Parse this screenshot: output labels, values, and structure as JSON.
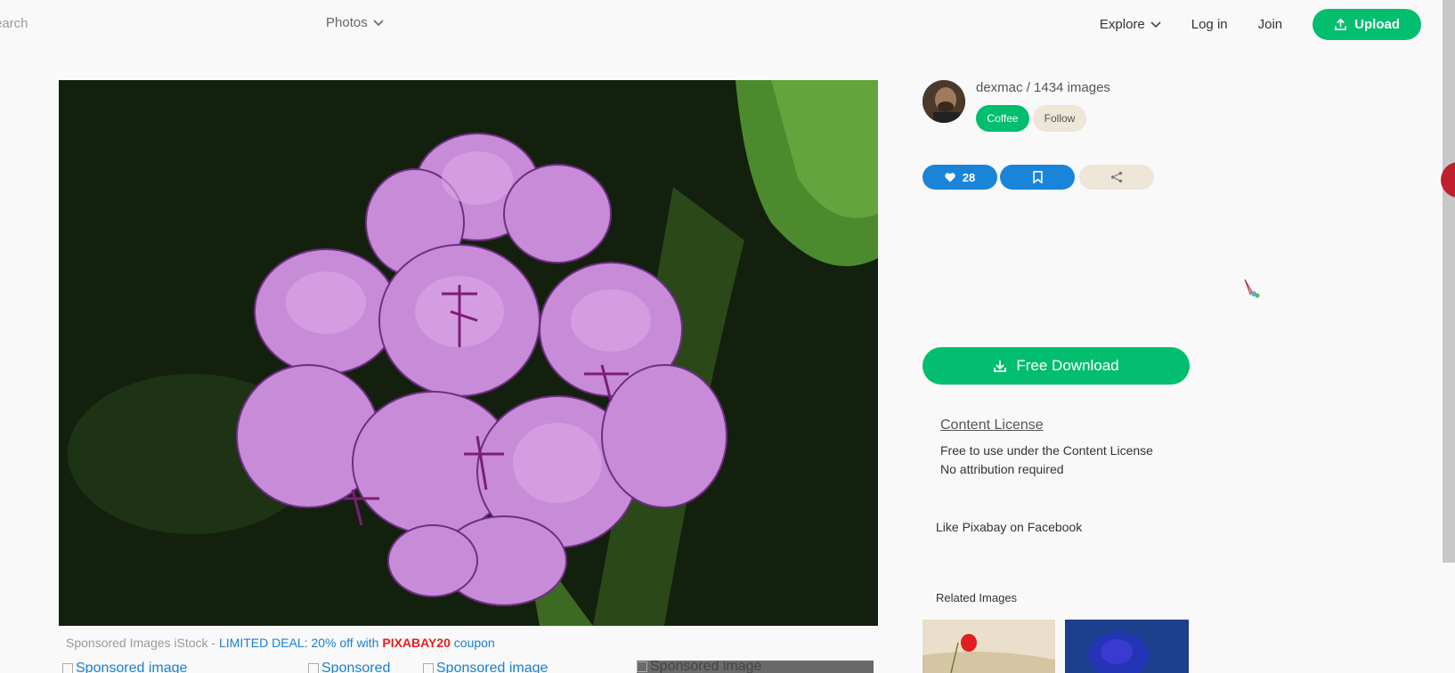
{
  "header": {
    "search_placeholder_visible": "earch",
    "media_type": "Photos",
    "explore": "Explore",
    "login": "Log in",
    "join": "Join",
    "upload": "Upload",
    "accent": "#02be6e"
  },
  "author": {
    "name_line": "dexmac / 1434 images",
    "coffee": "Coffee",
    "follow": "Follow"
  },
  "actions": {
    "likes": "28",
    "like_icon": "heart-icon",
    "bookmark_icon": "bookmark-icon",
    "share_icon": "share-icon"
  },
  "download": {
    "label": "Free Download",
    "icon": "download-icon"
  },
  "license": {
    "title": "Content License",
    "line1": "Free to use under the Content License",
    "line2": "No attribution required"
  },
  "facebook": {
    "label": "Like Pixabay on Facebook"
  },
  "related": {
    "title": "Related Images"
  },
  "sponsored": {
    "prefix": "Sponsored Images iStock - ",
    "deal": "LIMITED DEAL: 20% off with ",
    "code": "PIXABAY20",
    "suffix": " coupon",
    "images": [
      "Sponsored image",
      "Sponsored",
      "Sponsored image",
      "Sponsored image"
    ]
  }
}
